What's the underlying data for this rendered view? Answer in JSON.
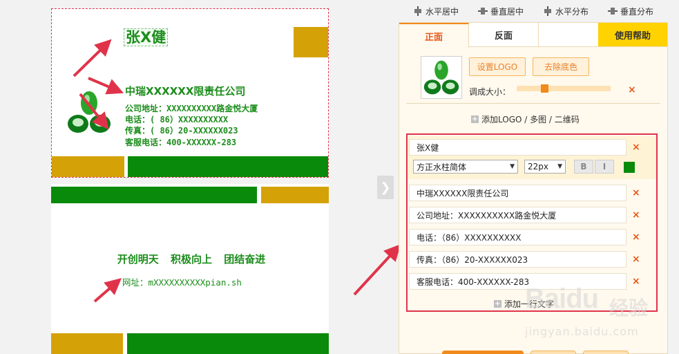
{
  "front_card": {
    "name": "张X健",
    "company": "中瑞XXXXXX限责任公司",
    "lines": [
      "公司地址：XXXXXXXXXX路金悦大厦",
      "电话：( 86）XXXXXXXXXX",
      "传真：( 86）20-XXXXXX023",
      "客服电话：400-XXXXXX-283"
    ]
  },
  "back_card": {
    "slogan": "开创明天 积极向上 团结奋进",
    "url": "网址：mXXXXXXXXXXpian.sh"
  },
  "toolbar": {
    "align_h_center": "水平居中",
    "align_v_center": "垂直居中",
    "distribute_h": "水平分布",
    "distribute_v": "垂直分布"
  },
  "tabs": {
    "front": "正面",
    "back": "反面",
    "help": "使用帮助"
  },
  "logo_panel": {
    "set_logo": "设置LOGO",
    "remove_bg": "去除底色",
    "resize_label": "调成大小：",
    "resize_value": 0.3,
    "add_logo_link": "添加LOGO / 多图 / 二维码"
  },
  "text_fields": {
    "name_value": "张X健",
    "font_family": "方正水柱简体",
    "font_size": "22px",
    "bold_label": "B",
    "italic_label": "I",
    "text_color": "#0a8a0a",
    "company": "中瑞XXXXXX限责任公司",
    "address": "公司地址：XXXXXXXXXX路金悦大厦",
    "phone": "电话：（86）XXXXXXXXXX",
    "fax": "传真：（86）20-XXXXXX023",
    "service": "客服电话：400-XXXXXX-283",
    "add_text": "添加一行文字"
  },
  "remove_glyph": "×",
  "next_glyph": "❯",
  "watermark": {
    "brand": "Baidu",
    "cn": "经验",
    "url": "jingyan.baidu.com"
  }
}
